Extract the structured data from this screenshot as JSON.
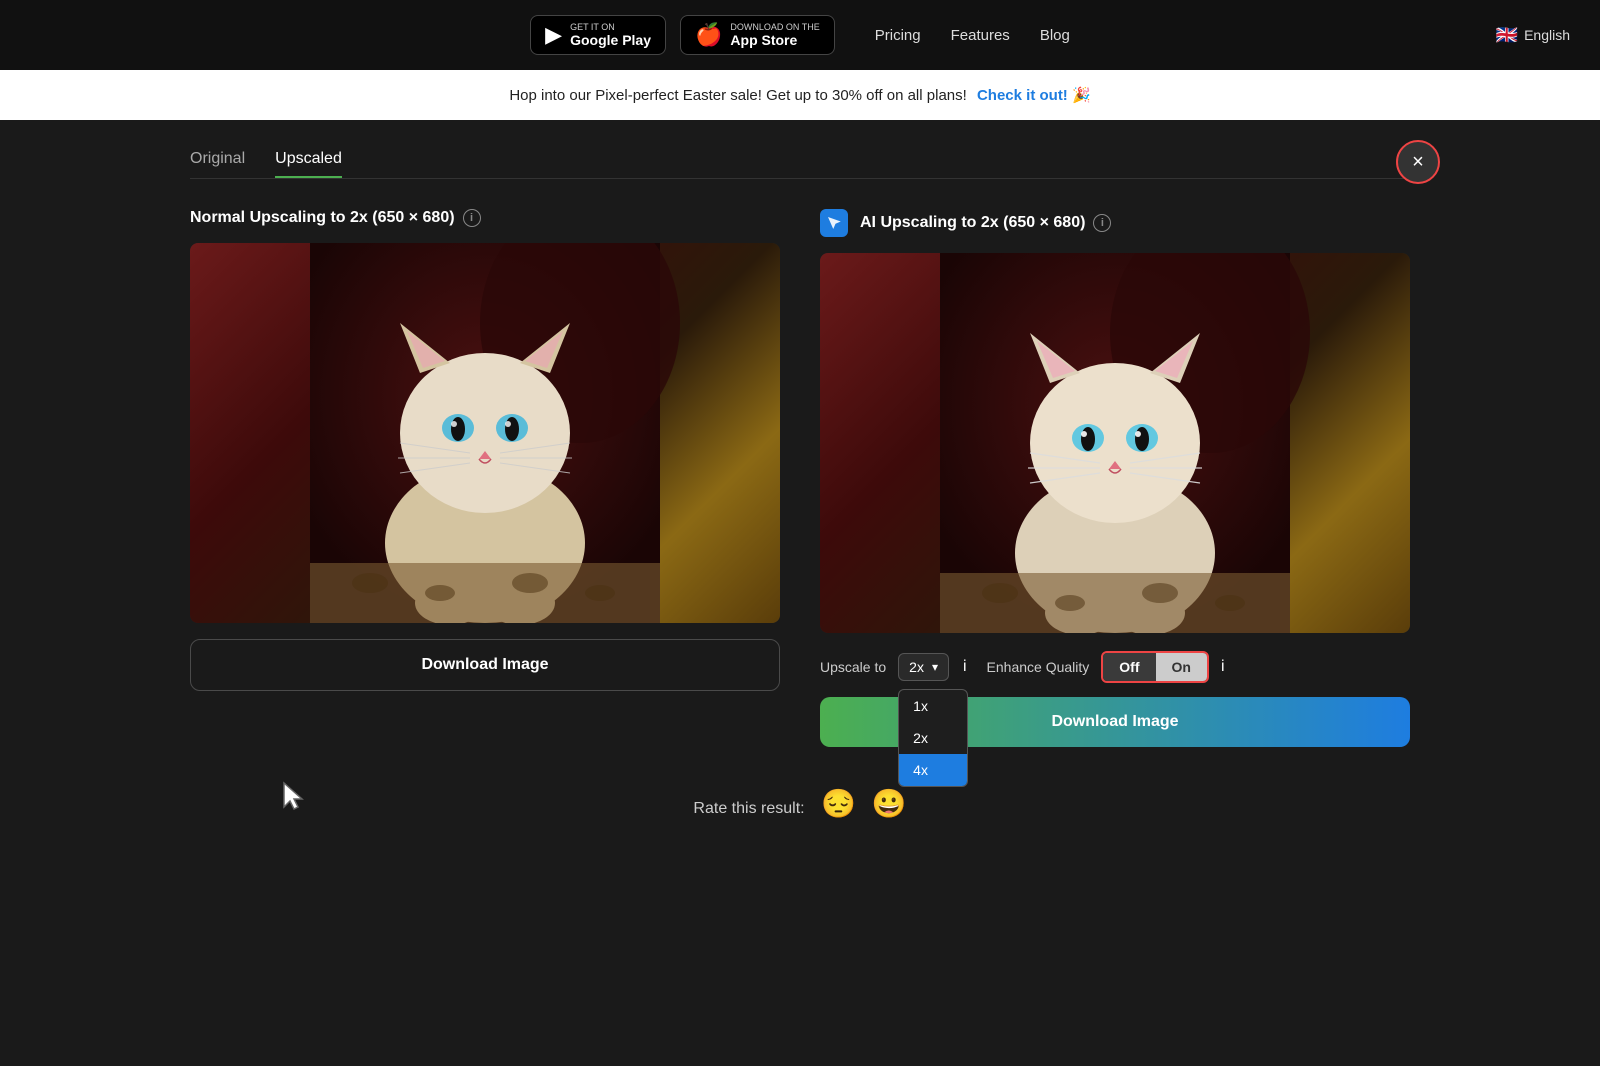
{
  "nav": {
    "google_play_label": "Google Play",
    "google_play_get_it": "GET IT ON",
    "app_store_label": "App Store",
    "app_store_get_it": "Download on the",
    "pricing": "Pricing",
    "features": "Features",
    "blog": "Blog",
    "language": "English"
  },
  "announcement": {
    "text": "Hop into our Pixel-perfect Easter sale! Get up to 30% off on all plans!",
    "link_text": "Check it out!",
    "emoji": "🎉"
  },
  "tabs": [
    {
      "label": "Original",
      "active": false
    },
    {
      "label": "Upscaled",
      "active": true
    }
  ],
  "left_panel": {
    "title": "Normal Upscaling to 2x (650 × 680)",
    "info_title": "Normal Upscaling Info",
    "download_label": "Download Image"
  },
  "right_panel": {
    "title": "AI Upscaling to 2x (650 × 680)",
    "info_title": "AI Upscaling Info",
    "upscale_label": "Upscale to",
    "upscale_value": "2x",
    "upscale_options": [
      "1x",
      "2x",
      "4x"
    ],
    "enhance_label": "Enhance Quality",
    "toggle_off": "Off",
    "toggle_on": "On",
    "download_label": "Download Image"
  },
  "dropdown": {
    "items": [
      {
        "label": "1x",
        "selected": false
      },
      {
        "label": "2x",
        "selected": false
      },
      {
        "label": "4x",
        "selected": true
      }
    ]
  },
  "rate": {
    "label": "Rate this result:",
    "sad_emoji": "😔",
    "happy_emoji": "😀"
  },
  "close_label": "×"
}
